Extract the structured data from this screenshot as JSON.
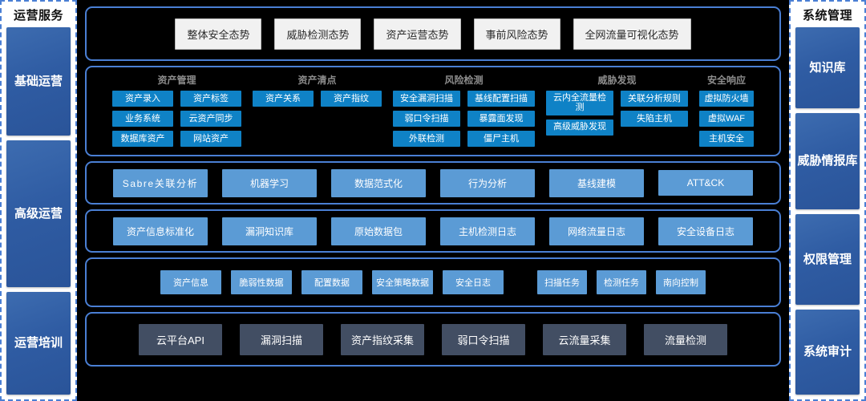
{
  "left_sidebar": {
    "title": "运营服务",
    "items": [
      {
        "label": "基础\n运营",
        "flex": 1
      },
      {
        "label": "高级\n运营",
        "flex": 1.35
      },
      {
        "label": "运营\n培训",
        "flex": 0.95
      }
    ]
  },
  "right_sidebar": {
    "title": "系统管理",
    "items": [
      {
        "label": "知识库",
        "flex": 1
      },
      {
        "label": "威胁\n情报库",
        "flex": 1.18
      },
      {
        "label": "权限\n管理",
        "flex": 1.12
      },
      {
        "label": "系统\n审计",
        "flex": 1.05
      }
    ]
  },
  "scenarios": {
    "tabs": [
      "整体安全态势",
      "威胁检测态势",
      "资产运营态势",
      "事前风险态势",
      "全网流量可视化态势"
    ]
  },
  "capabilities": {
    "groups": [
      {
        "title": "资产管理",
        "chip_width": "w-mid",
        "columns": [
          [
            "资产录入",
            "业务系统",
            "数据库资产"
          ],
          [
            "资产标签",
            "云资产同步",
            "网站资产"
          ]
        ]
      },
      {
        "title": "资产清点",
        "chip_width": "w-mid",
        "columns": [
          [
            "资产关系"
          ],
          [
            "资产指纹"
          ]
        ]
      },
      {
        "title": "风险检测",
        "chip_width": "w-wide",
        "columns": [
          [
            "安全漏洞扫描",
            "弱口令扫描",
            "外联检测"
          ],
          [
            "基线配置扫描",
            "暴露面发现",
            "僵尸主机"
          ]
        ]
      },
      {
        "title": "威胁发现",
        "chip_width": "w-wide",
        "columns": [
          [
            "云内全流量检\n测",
            "高级威胁发现"
          ],
          [
            "关联分析规则",
            "失陷主机"
          ]
        ]
      },
      {
        "title": "安全响应",
        "chip_width": "w-nar",
        "columns": [
          [
            "虚拟防火墙",
            "虚拟WAF",
            "主机安全"
          ]
        ]
      }
    ]
  },
  "analytics": {
    "chips": [
      {
        "label": "Sabre关联分析",
        "spaced": true
      },
      {
        "label": "机器学习",
        "spaced": false
      },
      {
        "label": "数据范式化",
        "spaced": false
      },
      {
        "label": "行为分析",
        "spaced": false
      },
      {
        "label": "基线建模",
        "spaced": false
      },
      {
        "label": "ATT&CK",
        "spaced": false
      }
    ]
  },
  "data_layer": {
    "chips": [
      "资产信息标准化",
      "漏洞知识库",
      "原始数据包",
      "主机检测日志",
      "网络流量日志",
      "安全设备日志"
    ]
  },
  "objects": {
    "group_a": [
      "资产信息",
      "脆弱性数据",
      "配置数据",
      "安全策略数据",
      "安全日志"
    ],
    "group_b": [
      "扫描任务",
      "检测任务",
      "南向控制"
    ]
  },
  "collectors": {
    "chips": [
      "云平台API",
      "漏洞扫描",
      "资产指纹采集",
      "弱口令扫描",
      "云流量采集",
      "流量检测"
    ]
  },
  "colors": {
    "board_bg": "#000000",
    "section_border": "#4a7fd4",
    "capability_chip": "#0f82c6",
    "analytics_chip": "#5b9bd5",
    "collector_chip": "#424e63",
    "tab_chip": "#f1f1f1",
    "sidebar_panel": "#2f5ca3"
  }
}
